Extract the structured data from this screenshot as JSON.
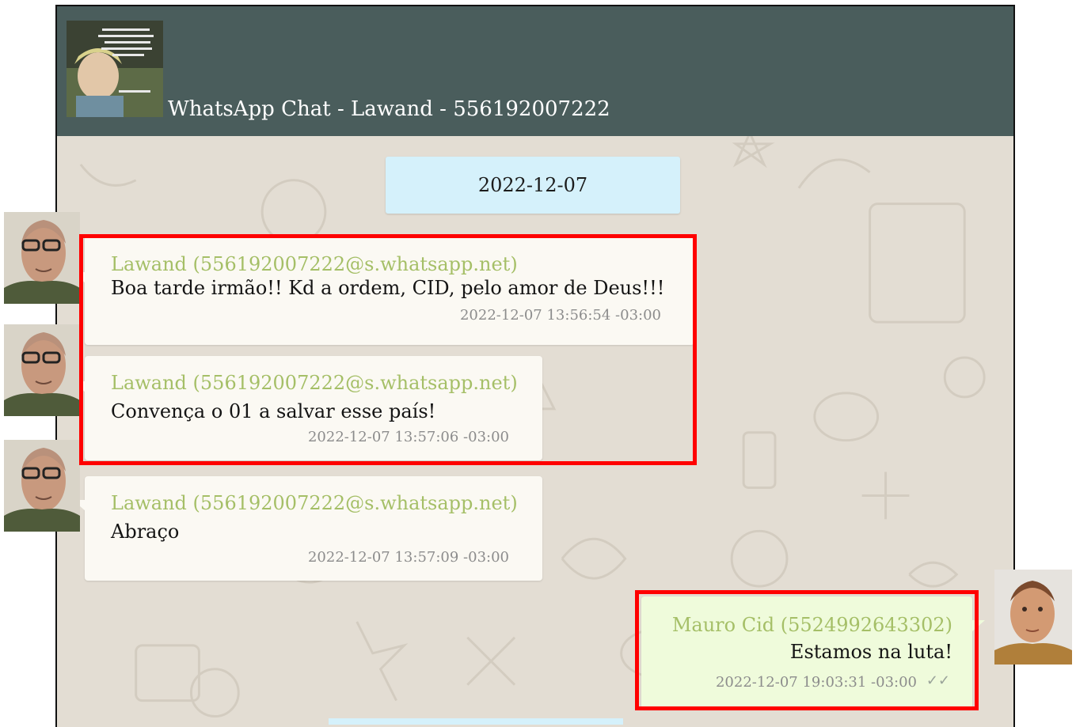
{
  "header": {
    "title": "WhatsApp Chat - Lawand - 556192007222",
    "avatar_icon": "profile-picture"
  },
  "date_separator": "2022-12-07",
  "messages": [
    {
      "sender": "Lawand (556192007222@s.whatsapp.net)",
      "text": "Boa tarde irmão!! Kd a ordem, CID, pelo amor de Deus!!!",
      "timestamp": "2022-12-07 13:56:54 -03:00",
      "direction": "incoming"
    },
    {
      "sender": "Lawand (556192007222@s.whatsapp.net)",
      "text": "Convença o 01 a salvar esse país!",
      "timestamp": "2022-12-07 13:57:06 -03:00",
      "direction": "incoming"
    },
    {
      "sender": "Lawand (556192007222@s.whatsapp.net)",
      "text": "Abraço",
      "timestamp": "2022-12-07 13:57:09 -03:00",
      "direction": "incoming"
    },
    {
      "sender": "Mauro Cid (5524992643302)",
      "text": "Estamos na luta!",
      "timestamp": "2022-12-07 19:03:31 -03:00",
      "direction": "outgoing",
      "status_icon": "double-check-icon",
      "status_glyph": "✓✓"
    }
  ],
  "colors": {
    "header_bg": "#4a5d5c",
    "chat_bg": "#e3ddd3",
    "incoming_bubble": "#fbf9f3",
    "outgoing_bubble": "#effbdb",
    "sender_name": "#a5bf67",
    "date_pill": "#d5f1fb",
    "highlight": "#ff0000"
  }
}
